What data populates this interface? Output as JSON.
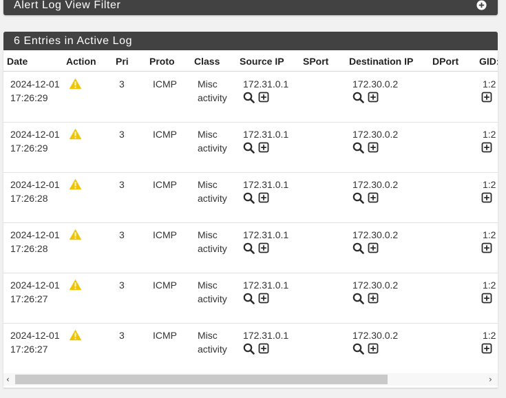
{
  "filter_panel": {
    "title": "Alert Log View Filter",
    "toggle_icon": "plus-circle-icon"
  },
  "log_panel": {
    "title": "6 Entries in Active Log"
  },
  "columns": [
    "Date",
    "Action",
    "Pri",
    "Proto",
    "Class",
    "Source IP",
    "SPort",
    "Destination IP",
    "DPort",
    "GID:"
  ],
  "rows": [
    {
      "date": "2024-12-01",
      "time": "17:26:29",
      "action_icon": "warning-icon",
      "pri": "3",
      "proto": "ICMP",
      "class_1": "Misc",
      "class_2": "activity",
      "src_ip": "172.31.0.1",
      "sport": "",
      "dst_ip": "172.30.0.2",
      "dport": "",
      "gid": "1:2"
    },
    {
      "date": "2024-12-01",
      "time": "17:26:29",
      "action_icon": "warning-icon",
      "pri": "3",
      "proto": "ICMP",
      "class_1": "Misc",
      "class_2": "activity",
      "src_ip": "172.31.0.1",
      "sport": "",
      "dst_ip": "172.30.0.2",
      "dport": "",
      "gid": "1:2"
    },
    {
      "date": "2024-12-01",
      "time": "17:26:28",
      "action_icon": "warning-icon",
      "pri": "3",
      "proto": "ICMP",
      "class_1": "Misc",
      "class_2": "activity",
      "src_ip": "172.31.0.1",
      "sport": "",
      "dst_ip": "172.30.0.2",
      "dport": "",
      "gid": "1:2"
    },
    {
      "date": "2024-12-01",
      "time": "17:26:28",
      "action_icon": "warning-icon",
      "pri": "3",
      "proto": "ICMP",
      "class_1": "Misc",
      "class_2": "activity",
      "src_ip": "172.31.0.1",
      "sport": "",
      "dst_ip": "172.30.0.2",
      "dport": "",
      "gid": "1:2"
    },
    {
      "date": "2024-12-01",
      "time": "17:26:27",
      "action_icon": "warning-icon",
      "pri": "3",
      "proto": "ICMP",
      "class_1": "Misc",
      "class_2": "activity",
      "src_ip": "172.31.0.1",
      "sport": "",
      "dst_ip": "172.30.0.2",
      "dport": "",
      "gid": "1:2"
    },
    {
      "date": "2024-12-01",
      "time": "17:26:27",
      "action_icon": "warning-icon",
      "pri": "3",
      "proto": "ICMP",
      "class_1": "Misc",
      "class_2": "activity",
      "src_ip": "172.31.0.1",
      "sport": "",
      "dst_ip": "172.30.0.2",
      "dport": "",
      "gid": "1:2"
    }
  ],
  "colors": {
    "header_bg": "#424242",
    "warning": "#f0c400",
    "table_bg": "#ffffff",
    "scroll_thumb": "#c9c9c9"
  }
}
